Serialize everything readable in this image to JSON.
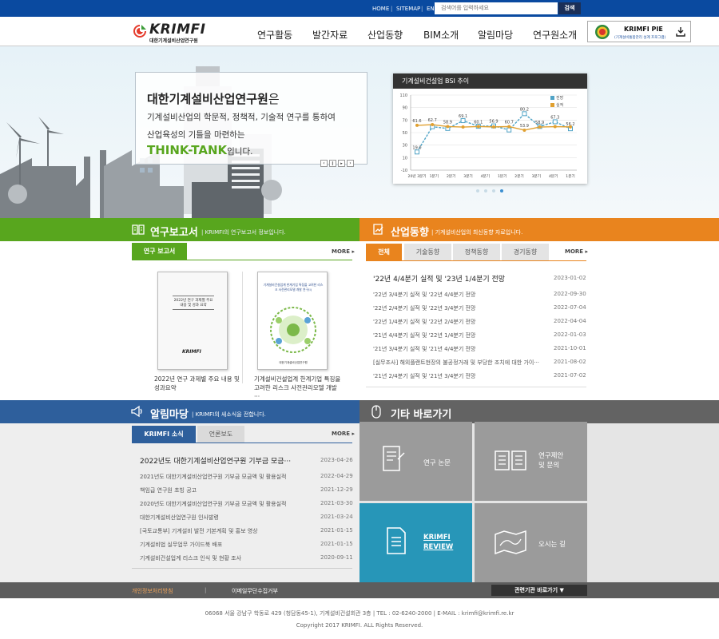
{
  "topbar": {
    "home": "HOME",
    "sitemap": "SITEMAP",
    "english": "ENGLISH",
    "search_placeholder": "검색어를 입력하세요",
    "search_button": "검색"
  },
  "logo": {
    "main": "KRIMFI",
    "sub": "대한기계설비산업연구원"
  },
  "nav": [
    "연구활동",
    "발간자료",
    "산업동향",
    "BIM소개",
    "알림마당",
    "연구원소개"
  ],
  "pie": {
    "title": "KRIMFI PIE",
    "sub": "(기계설비통합관리 설계 프로그램)"
  },
  "hero": {
    "l1_bold": "대한기계설비산업연구원",
    "l1_rest": "은",
    "l2": "기계설비산업의 학문적, 정책적, 기술적 연구를 통하여",
    "l3": "산업육성의 기틀을 마련하는",
    "l4_green": "THINK-TANK",
    "l4_rest": "입니다."
  },
  "chart_data": {
    "type": "line",
    "title": "기계설비건설업 BSI 추이",
    "categories": [
      "20년 3분기",
      "20년 4분기",
      "21년 1분기",
      "21년 2분기",
      "21년 3분기",
      "21년 4분기",
      "22년 1분기",
      "22년 2분기",
      "22년 3분기",
      "22년 4분기",
      "23년 1분기"
    ],
    "series": [
      {
        "name": "전망",
        "values": [
          19,
          59.4,
          56.6,
          69.1,
          60.1,
          60.7,
          54.2,
          80.2,
          59.8,
          67.3,
          56.2
        ],
        "color": "#4fa3c6"
      },
      {
        "name": "실적",
        "values": [
          61.6,
          62.7,
          59.7,
          58.9,
          59.7,
          59.1,
          59.6,
          53.9,
          58.9,
          59.5,
          59.1
        ],
        "color": "#e0a030"
      }
    ],
    "data_labels": [
      "19.0",
      "61.6",
      "62.7",
      "58.9",
      "69.1",
      "60.1",
      "56.9",
      "60.7",
      "80.2",
      "53.9",
      "58.9",
      "67.3",
      "56.2"
    ],
    "ylim": [
      -10,
      110
    ],
    "yticks": [
      -10,
      10,
      30,
      50,
      70,
      90,
      110
    ],
    "xticklabels": [
      "20년 3분기",
      "1분기",
      "2분기",
      "3분기",
      "4분기",
      "1분기",
      "2분기",
      "3분기",
      "4분기",
      "1분기"
    ],
    "legend_position": "top-right",
    "grid": true
  },
  "research": {
    "title": "연구보고서",
    "subtitle": "KRIMFI의 연구보고서 정보입니다.",
    "tab": "연구 보고서",
    "more": "MORE ▸",
    "books": [
      {
        "cover_title": "2022년 연구 과제별 주요 내용 및 성과 요약",
        "cover_logo": "KRIMFI",
        "caption": "2022년 연구 과제별 주요 내용 및 성과요약"
      },
      {
        "cover_title": "기계설비건설업계 한계기업 특징을 고려한 리스크 사전관리모델 개발 연구(I)",
        "cover_sub": "대한기계설비산업연구원",
        "caption": "기계설비건설업계 한계기업 특징을 고려한 리스크 사전관리모델 개발 ···"
      }
    ]
  },
  "industry": {
    "title": "산업동향",
    "subtitle": "기계설비산업의 최신동향 자료입니다.",
    "tabs": [
      "전체",
      "기술동향",
      "정책동향",
      "경기동향"
    ],
    "more": "MORE ▸",
    "items": [
      {
        "t": "'22년 4/4분기 실적 및 '23년 1/4분기 전망",
        "d": "2023-01-02"
      },
      {
        "t": "'22년 3/4분기 실적 및 '22년 4/4분기 전망",
        "d": "2022-09-30"
      },
      {
        "t": "'22년 2/4분기 실적 및 '22년 3/4분기 전망",
        "d": "2022-07-04"
      },
      {
        "t": "'22년 1/4분기 실적 및 '22년 2/4분기 전망",
        "d": "2022-04-04"
      },
      {
        "t": "'21년 4/4분기 실적 및 '22년 1/4분기 전망",
        "d": "2022-01-03"
      },
      {
        "t": "'21년 3/4분기 실적 및 '21년 4/4분기 전망",
        "d": "2021-10-01"
      },
      {
        "t": "[실무조사] 해외플랜트현장의 불공정거래 및 부당한 조치에 대한 가이···",
        "d": "2021-08-02"
      },
      {
        "t": "'21년 2/4분기 실적 및 '21년 3/4분기 전망",
        "d": "2021-07-02"
      }
    ]
  },
  "notice": {
    "title": "알림마당",
    "subtitle": "KRIMFI의 새소식을 전합니다.",
    "tabs": [
      "KRIMFI 소식",
      "언론보도"
    ],
    "more": "MORE ▸",
    "items": [
      {
        "t": "2022년도 대한기계설비산업연구원 기부금 모금···",
        "d": "2023-04-26"
      },
      {
        "t": "2021년도 대한기계설비산업연구원 기부금 모금액 및 활용실적",
        "d": "2022-04-29"
      },
      {
        "t": "책임급 연구원 초빙 공고",
        "d": "2021-12-29"
      },
      {
        "t": "2020년도 대한기계설비산업연구원 기부금 모금액 및 활용실적",
        "d": "2021-03-30"
      },
      {
        "t": "대한기계설비산업연구원 인사발령",
        "d": "2021-03-24"
      },
      {
        "t": "[국토교통부] 기계설비 발전 기본계획 및 홍보 영상",
        "d": "2021-01-15"
      },
      {
        "t": "기계설비법 실무업무 가이드북 배포",
        "d": "2021-01-15"
      },
      {
        "t": "기계설비건설업계 리스크 인식 및 현황 조사",
        "d": "2020-09-11"
      }
    ]
  },
  "shortcuts": {
    "title": "기타 바로가기",
    "tiles": [
      "연구 논문",
      "연구제안\n및 문의",
      "KRIMFI\nREVIEW",
      "오시는 길"
    ]
  },
  "footer": {
    "privacy": "개인정보처리방침",
    "email_policy": "이메일무단수집거부",
    "related": "관련기관 바로가기 ▼",
    "address": "06068 서울 강남구 학동로 429 (청담동45-1), 기계설비건설회관 3층 | TEL : 02-6240-2000 | E-MAIL : krimfi@krimfi.re.kr",
    "copyright": "Copyright 2017 KRIMFI. ALL Rights Reserved."
  },
  "colors": {
    "blue": "#0a4aa0",
    "green": "#58a61e",
    "orange": "#e9841e",
    "navy": "#2e5f9c",
    "gray": "#666666",
    "teal": "#2796b8"
  }
}
